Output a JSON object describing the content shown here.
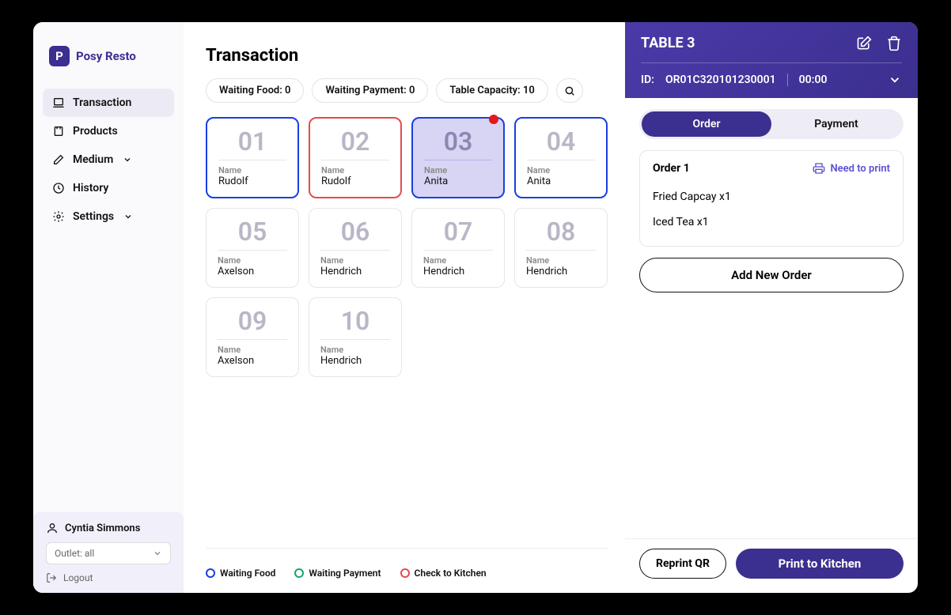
{
  "brand": {
    "badge": "P",
    "name": "Posy Resto"
  },
  "nav": {
    "transaction": "Transaction",
    "products": "Products",
    "medium": "Medium",
    "history": "History",
    "settings": "Settings"
  },
  "user": {
    "name": "Cyntia Simmons",
    "outlet": "Outlet: all",
    "logout": "Logout"
  },
  "page": {
    "title": "Transaction"
  },
  "filters": {
    "waiting_food": "Waiting Food: 0",
    "waiting_payment": "Waiting Payment: 0",
    "table_capacity": "Table Capacity: 10"
  },
  "name_label": "Name",
  "tables": [
    {
      "num": "01",
      "name": "Rudolf",
      "state": "blue"
    },
    {
      "num": "02",
      "name": "Rudolf",
      "state": "red"
    },
    {
      "num": "03",
      "name": "Anita",
      "state": "selected",
      "dot": true
    },
    {
      "num": "04",
      "name": "Anita",
      "state": "blue"
    },
    {
      "num": "05",
      "name": "Axelson",
      "state": ""
    },
    {
      "num": "06",
      "name": "Hendrich",
      "state": ""
    },
    {
      "num": "07",
      "name": "Hendrich",
      "state": ""
    },
    {
      "num": "08",
      "name": "Hendrich",
      "state": ""
    },
    {
      "num": "09",
      "name": "Axelson",
      "state": ""
    },
    {
      "num": "10",
      "name": "Hendrich",
      "state": ""
    }
  ],
  "legend": {
    "waiting_food": "Waiting Food",
    "waiting_payment": "Waiting Payment",
    "check_kitchen": "Check to Kitchen"
  },
  "colors": {
    "blue": "#1a3fe0",
    "green": "#17a66b",
    "red": "#e24c4c",
    "brand": "#3b2f8f"
  },
  "panel": {
    "title": "TABLE 3",
    "id_label": "ID:",
    "order_id": "OR01C320101230001",
    "time": "00:00",
    "tabs": {
      "order": "Order",
      "payment": "Payment"
    },
    "order_title": "Order 1",
    "print_tag": "Need to print",
    "items": [
      "Fried Capcay x1",
      "Iced Tea x1"
    ],
    "add_order": "Add New Order",
    "reprint": "Reprint QR",
    "print_kitchen": "Print to Kitchen"
  }
}
